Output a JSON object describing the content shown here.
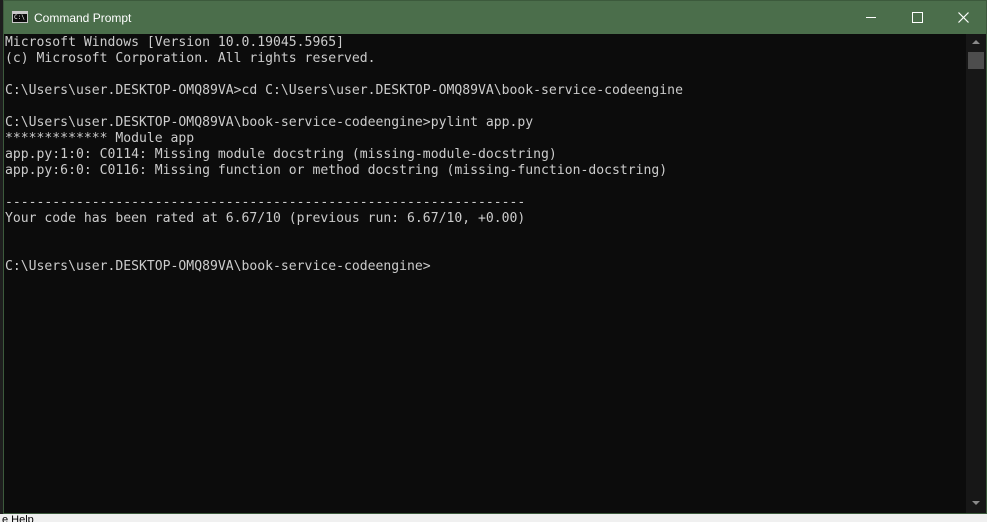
{
  "window": {
    "title": "Command Prompt",
    "app_icon_text": "C:\\",
    "close_glyph": "✕"
  },
  "console": {
    "lines": [
      "Microsoft Windows [Version 10.0.19045.5965]",
      "(c) Microsoft Corporation. All rights reserved.",
      "",
      "C:\\Users\\user.DESKTOP-OMQ89VA>cd C:\\Users\\user.DESKTOP-OMQ89VA\\book-service-codeengine",
      "",
      "C:\\Users\\user.DESKTOP-OMQ89VA\\book-service-codeengine>pylint app.py",
      "************* Module app",
      "app.py:1:0: C0114: Missing module docstring (missing-module-docstring)",
      "app.py:6:0: C0116: Missing function or method docstring (missing-function-docstring)",
      "",
      "------------------------------------------------------------------",
      "Your code has been rated at 6.67/10 (previous run: 6.67/10, +0.00)",
      "",
      "",
      "C:\\Users\\user.DESKTOP-OMQ89VA\\book-service-codeengine>"
    ]
  },
  "background": {
    "bottom_text": "e Help"
  },
  "colors": {
    "titlebar": "#4b6e4b",
    "console_bg": "#0c0c0c",
    "console_text": "#cccccc"
  }
}
